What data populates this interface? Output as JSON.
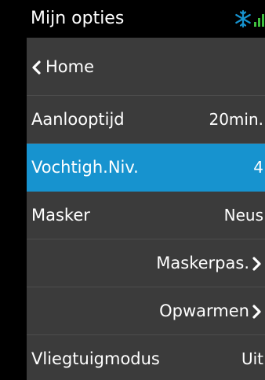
{
  "header": {
    "title": "Mijn opties",
    "icons": [
      "snowflake-icon",
      "signal-icon"
    ],
    "accent": "#1793cf",
    "signal_color": "#3fbf3f"
  },
  "menu": {
    "back_label": "Home",
    "items": [
      {
        "label": "Aanlooptijd",
        "value": "20min."
      },
      {
        "label": "Vochtigh.Niv.",
        "value": "4",
        "selected": true
      },
      {
        "label": "Masker",
        "value": "Neus"
      },
      {
        "label": "Maskerpas."
      },
      {
        "label": "Opwarmen"
      },
      {
        "label": "Vliegtuigmodus",
        "value": "Uit"
      }
    ]
  }
}
